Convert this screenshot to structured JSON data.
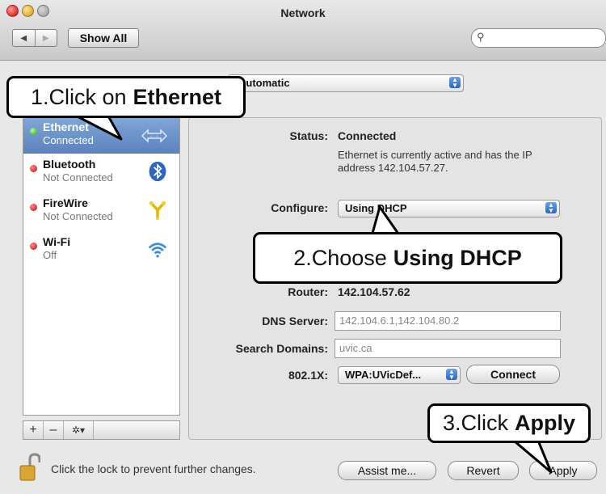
{
  "window": {
    "title": "Network"
  },
  "toolbar": {
    "back": "◀",
    "forward": "▶",
    "show_all": "Show All",
    "search_placeholder": ""
  },
  "location": {
    "value": "Automatic"
  },
  "services": [
    {
      "name": "Ethernet",
      "status": "Connected",
      "icon": "ethernet-icon",
      "selected": true,
      "indicator": "green"
    },
    {
      "name": "Bluetooth",
      "status": "Not Connected",
      "icon": "bluetooth-icon",
      "selected": false,
      "indicator": "red"
    },
    {
      "name": "FireWire",
      "status": "Not Connected",
      "icon": "firewire-icon",
      "selected": false,
      "indicator": "red"
    },
    {
      "name": "Wi-Fi",
      "status": "Off",
      "icon": "wifi-icon",
      "selected": false,
      "indicator": "red"
    }
  ],
  "sidebar_buttons": {
    "add": "+",
    "remove": "–",
    "gear": "✲▾"
  },
  "details": {
    "status_label": "Status:",
    "status_value": "Connected",
    "status_desc_line1": "Ethernet is currently active and has the IP",
    "status_desc_line2": "address 142.104.57.27.",
    "configure_label": "Configure:",
    "configure_value": "Using DHCP",
    "router_label": "Router:",
    "router_value": "142.104.57.62",
    "dns_label": "DNS Server:",
    "dns_value": "142.104.6.1,142.104.80.2",
    "search_label": "Search Domains:",
    "search_value": "uvic.ca",
    "dot1x_label": "802.1X:",
    "dot1x_value": "WPA:UVicDef...",
    "connect_button": "Connect"
  },
  "bottom": {
    "lock_text": "Click the lock to prevent further changes.",
    "assist_button": "Assist me...",
    "revert_button": "Revert",
    "apply_button": "Apply"
  },
  "callouts": [
    {
      "prefix": "1.Click on",
      "emphasis": "Ethernet"
    },
    {
      "prefix": "2.Choose",
      "emphasis": "Using DHCP"
    },
    {
      "prefix": "3.Click",
      "emphasis": "Apply"
    }
  ],
  "colors": {
    "selection": "#6b92cb",
    "accent_blue": "#2a66c6",
    "status_green": "#2c9c10",
    "status_red": "#cc0000"
  }
}
